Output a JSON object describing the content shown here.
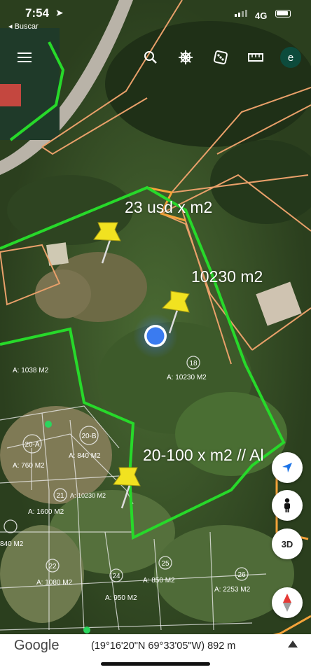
{
  "status_bar": {
    "time": "7:54",
    "back_label": "◂ Buscar",
    "network": "4G"
  },
  "toolbar": {
    "avatar_letter": "e"
  },
  "map_labels": {
    "price_1": "23 usd x m2",
    "area_main": "10230 m2",
    "price_2": "20-100 x m2 // Al"
  },
  "lots": [
    {
      "number": "18",
      "area": "A: 10230 M2"
    },
    {
      "number": "",
      "area": "A: 1038 M2"
    },
    {
      "number": "20-A",
      "area": "A: 760 M2"
    },
    {
      "number": "20-B",
      "area": "A: 840 M2"
    },
    {
      "number": "21",
      "area": "A: 10230 M2"
    },
    {
      "number": "",
      "area": "A: 1600 M2"
    },
    {
      "number": "",
      "area": "840 M2"
    },
    {
      "number": "22",
      "area": "A: 1080 M2"
    },
    {
      "number": "24",
      "area": "A: 950 M2"
    },
    {
      "number": "25",
      "area": "A: 850 M2"
    },
    {
      "number": "26",
      "area": "A: 2253 M2"
    }
  ],
  "controls": {
    "view_3d": "3D"
  },
  "bottom": {
    "logo": "Google",
    "coordinates": "(19°16'20\"N 69°33'05\"W) 892 m"
  }
}
